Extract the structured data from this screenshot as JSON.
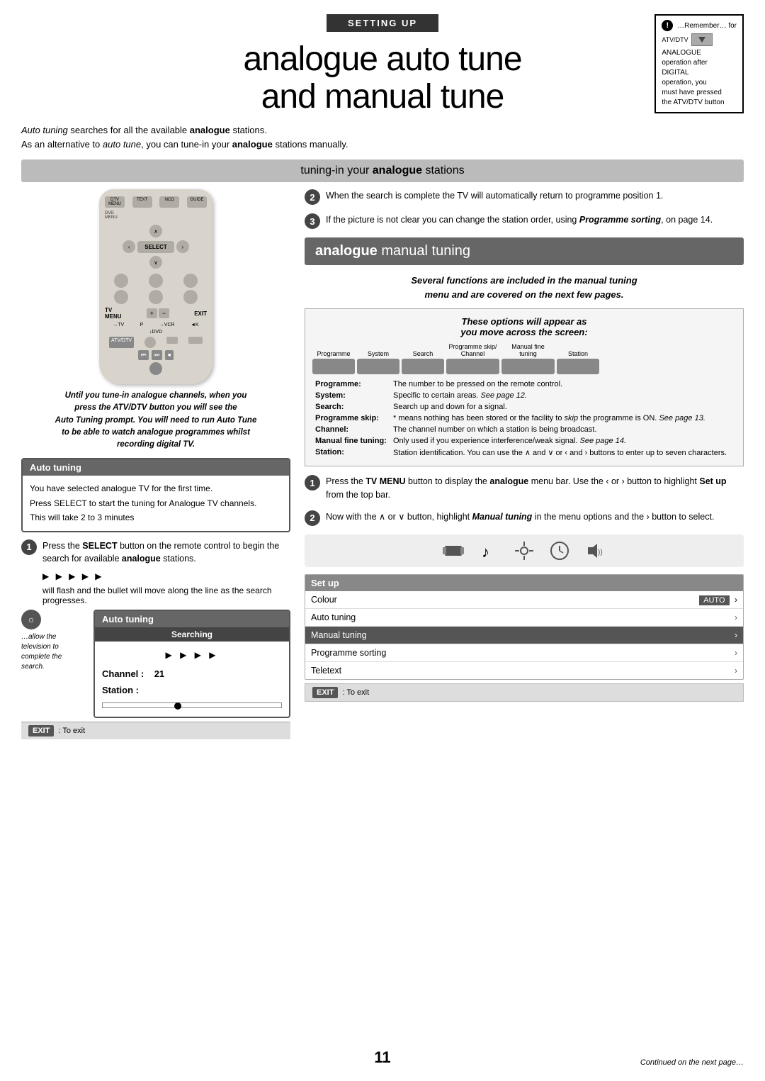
{
  "page": {
    "number": "11",
    "continued": "Continued on the next page…"
  },
  "header": {
    "setting_up": "SETTING UP",
    "title_line1": "analogue auto tune",
    "title_line2": "and manual tune"
  },
  "remember_box": {
    "exclamation": "!",
    "text_line1": "…Remember… for",
    "text_line2": "ANALOGUE",
    "text_line3": "operation after",
    "text_line4": "DIGITAL",
    "text_line5": "operation, you",
    "text_line6": "must have pressed",
    "text_line7": "the ATV/DTV button",
    "atv_dtv": "ATV/DTV"
  },
  "intro": {
    "line1_italic": "Auto tuning",
    "line1_rest": " searches for all the available ",
    "line1_bold": "analogue",
    "line1_end": " stations.",
    "line2_start": "As an alternative to ",
    "line2_italic": "auto tune",
    "line2_mid": ", you can tune-in your ",
    "line2_bold": "analogue",
    "line2_end": " stations manually."
  },
  "tuning_banner": {
    "text": "tuning-in your ",
    "bold": "analogue",
    "rest": " stations"
  },
  "left_col": {
    "italic_note": {
      "line1": "Until you tune-in analogue channels, when you",
      "line2": "press the ATV/DTV button you will see the",
      "line3": "Auto Tuning prompt. You will need to run Auto Tune",
      "line4": "to be able to watch analogue programmes whilst",
      "line5": "recording digital TV."
    },
    "auto_tuning_box": {
      "header": "Auto tuning",
      "line1": "You have selected analogue TV for the first time.",
      "line2": "Press SELECT to start the tuning for Analogue TV channels.",
      "line3": "This will take 2 to 3 minutes"
    },
    "step1": {
      "number": "1",
      "text": "Press the ",
      "bold": "SELECT",
      "rest": " button on the remote control to begin the search for available ",
      "bold2": "analogue",
      "end": " stations."
    },
    "bullet_arrows": "▶ ▶ ▶ ▶ ▶",
    "bullet_line": "will flash and the bullet will move along the line as the search progresses.",
    "searching_note": "…allow the television to complete the search.",
    "searching_box": {
      "outer_header": "Auto tuning",
      "inner_header": "Searching",
      "arrows": "▶ ▶ ▶ ▶",
      "channel_label": "Channel :",
      "channel_value": "21",
      "station_label": "Station :"
    },
    "exit_label": "EXIT",
    "exit_text": ": To exit"
  },
  "right_col": {
    "step2_right": {
      "number": "2",
      "text": "When the search is complete the TV will automatically return to programme position 1."
    },
    "step3_right": {
      "number": "3",
      "text": "If the picture is not clear you can change the station order, using ",
      "italic_bold": "Programme sorting",
      "end": ", on page 14."
    },
    "analogue_manual": {
      "bold": "analogue",
      "rest": " manual tuning"
    },
    "manual_bold_note": {
      "line1": "Several functions are included in the manual tuning",
      "line2": "menu and are covered on the next few pages."
    },
    "options_box": {
      "title_line1": "These options will appear as",
      "title_line2": "you move across the screen:",
      "menu_items": [
        "Programme",
        "System",
        "Search",
        "Programme skip/ Channel",
        "Manual fine tuning",
        "Station"
      ],
      "table": [
        {
          "label": "Programme:",
          "text": "The number to be pressed on the remote control."
        },
        {
          "label": "System:",
          "text": "Specific to certain areas. See page 12."
        },
        {
          "label": "Search:",
          "text": "Search up and down for a signal."
        },
        {
          "label": "Programme skip:",
          "text": "* means nothing has been stored or the facility to skip the programme is ON. See page 13."
        },
        {
          "label": "Channel:",
          "text": "The channel number on which a station is being broadcast."
        },
        {
          "label": "Manual fine tuning:",
          "text": "Only used if you experience interference/weak signal. See page 14."
        },
        {
          "label": "Station:",
          "text": "Station identification. You can use the ∧ and ∨ or ‹ and › buttons to enter up to seven characters."
        }
      ]
    },
    "step1_manual": {
      "number": "1",
      "text_start": "Press the ",
      "bold1": "TV MENU",
      "text_mid": " button to display the ",
      "bold2": "analogue",
      "text_mid2": " menu bar. Use the ‹ or › button to highlight ",
      "bold3": "Set up",
      "text_end": " from the top bar."
    },
    "step2_manual": {
      "number": "2",
      "text_start": "Now with the ∧ or ∨ button, highlight ",
      "italic_bold": "Manual tuning",
      "text_mid": " in the menu options and the › button to select."
    },
    "icons": [
      "🎵",
      "🎵",
      "⚙",
      "🕐",
      "🔊"
    ],
    "setup_menu": {
      "header": "Set up",
      "rows": [
        {
          "label": "Colour",
          "value": "AUTO",
          "highlighted": false,
          "arrow_right": true
        },
        {
          "label": "Auto tuning",
          "value": "",
          "highlighted": false,
          "arrow_right": true
        },
        {
          "label": "Manual tuning",
          "value": "",
          "highlighted": true,
          "arrow_right": true
        },
        {
          "label": "Programme sorting",
          "value": "",
          "highlighted": false,
          "arrow_right": true
        },
        {
          "label": "Teletext",
          "value": "",
          "highlighted": false,
          "arrow_right": true
        }
      ],
      "exit_label": "EXIT",
      "exit_text": ": To exit"
    }
  }
}
